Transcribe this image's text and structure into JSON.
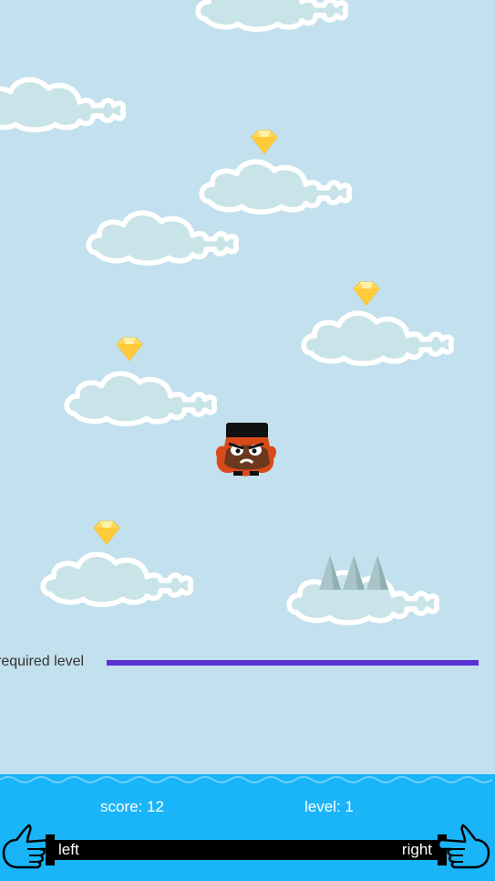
{
  "hud": {
    "score_label": "score: 12",
    "level_label": "level: 1"
  },
  "required_level": {
    "label": "required level",
    "line_color": "#5a2fd4"
  },
  "controls": {
    "left_label": "left",
    "right_label": "right"
  },
  "colors": {
    "sky": "#c2e0ed",
    "water": "#1ab4f8",
    "cloud_fill": "#c9e4e8",
    "cloud_outline": "#ffffff",
    "gem": "#ffd85c"
  },
  "icons": {
    "pickup": "yellow-gem-icon",
    "hazard": "gray-spike-icon",
    "player": "angry-bearded-character",
    "control": "pointing-hand-icon"
  }
}
